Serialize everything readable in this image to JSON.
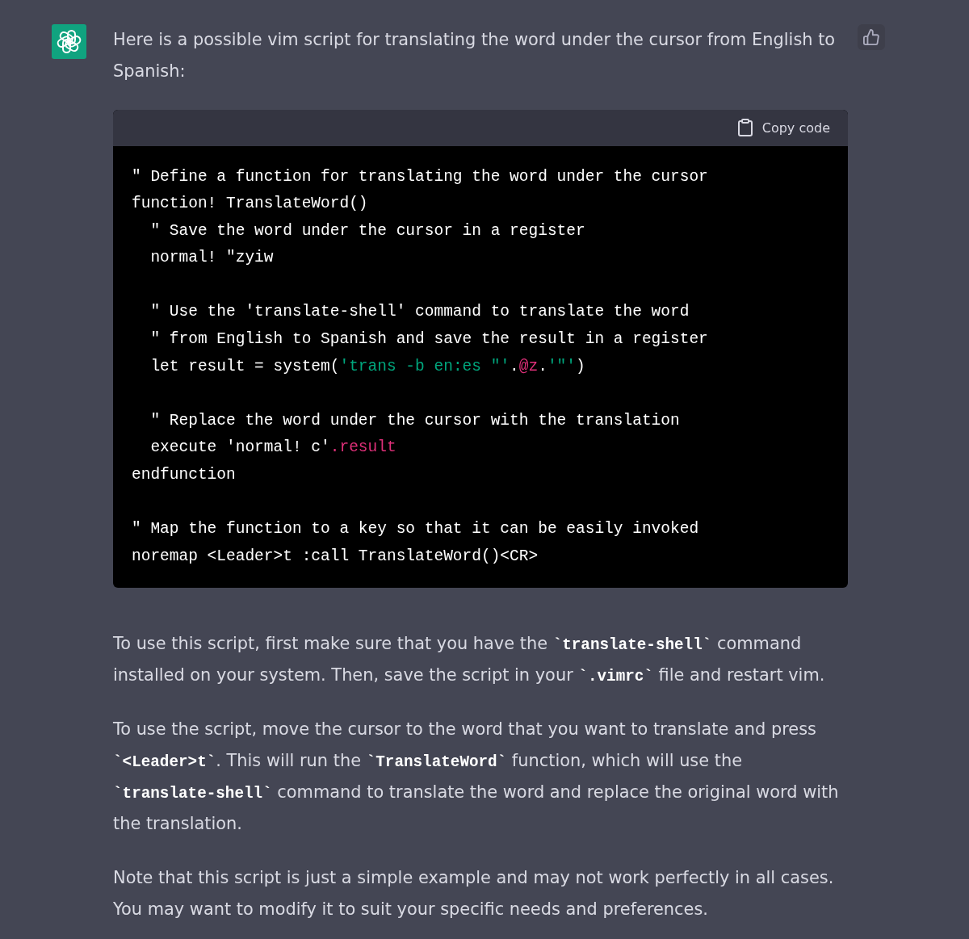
{
  "message": {
    "intro": "Here is a possible vim script for translating the word under the cursor from English to Spanish:",
    "code_block": {
      "copy_label": "Copy code",
      "blocks": [
        [
          {
            "segments": [
              {
                "text": "\" Define a function for translating the word under the cursor",
                "kind": "plain"
              }
            ]
          },
          {
            "segments": [
              {
                "text": "function! TranslateWord()",
                "kind": "plain"
              }
            ]
          },
          {
            "segments": [
              {
                "text": "  \" Save the word under the cursor in a register",
                "kind": "plain"
              }
            ]
          },
          {
            "segments": [
              {
                "text": "  normal! \"zyiw",
                "kind": "plain"
              }
            ]
          }
        ],
        [
          {
            "segments": [
              {
                "text": "  \" Use the 'translate-shell' command to translate the word",
                "kind": "plain"
              }
            ]
          },
          {
            "segments": [
              {
                "text": "  \" from English to Spanish and save the result in a register",
                "kind": "plain"
              }
            ]
          },
          {
            "segments": [
              {
                "text": "  let result = system(",
                "kind": "plain"
              },
              {
                "text": "'trans -b en:es \"'",
                "kind": "string",
                "operator": "."
              },
              {
                "text": "@z",
                "kind": "variable",
                "operator": "."
              },
              {
                "text": "'\"'",
                "kind": "string"
              },
              {
                "text": ")",
                "kind": "plain"
              }
            ]
          }
        ],
        [
          {
            "segments": [
              {
                "text": "  \" Replace the word under the cursor with the translation",
                "kind": "plain"
              }
            ]
          },
          {
            "segments": [
              {
                "text": "  execute 'normal! c'",
                "kind": "plain"
              },
              {
                "text": ".result",
                "kind": "variable"
              }
            ]
          },
          {
            "segments": [
              {
                "text": "endfunction",
                "kind": "plain"
              }
            ]
          }
        ],
        [
          {
            "segments": [
              {
                "text": "\" Map the function to a key so that it can be easily invoked",
                "kind": "plain"
              }
            ]
          },
          {
            "segments": [
              {
                "text": "noremap <Leader>t :call TranslateWord()<CR>",
                "kind": "plain"
              }
            ]
          }
        ]
      ]
    },
    "paragraphs": [
      "To use this script, first make sure that you have the **`translate-shell`** command installed on your system. Then, save the script in your **`.vimrc`** file and restart vim.",
      "To use the script, move the cursor to the word that you want to translate and press **`<Leader>t`**. This will run the **`TranslateWord`** function, which will use the **`translate-shell`** command to translate the word and replace the original word with the translation.",
      "Note that this script is just a simple example and may not work perfectly in all cases. You may want to modify it to suit your specific needs and preferences."
    ]
  }
}
